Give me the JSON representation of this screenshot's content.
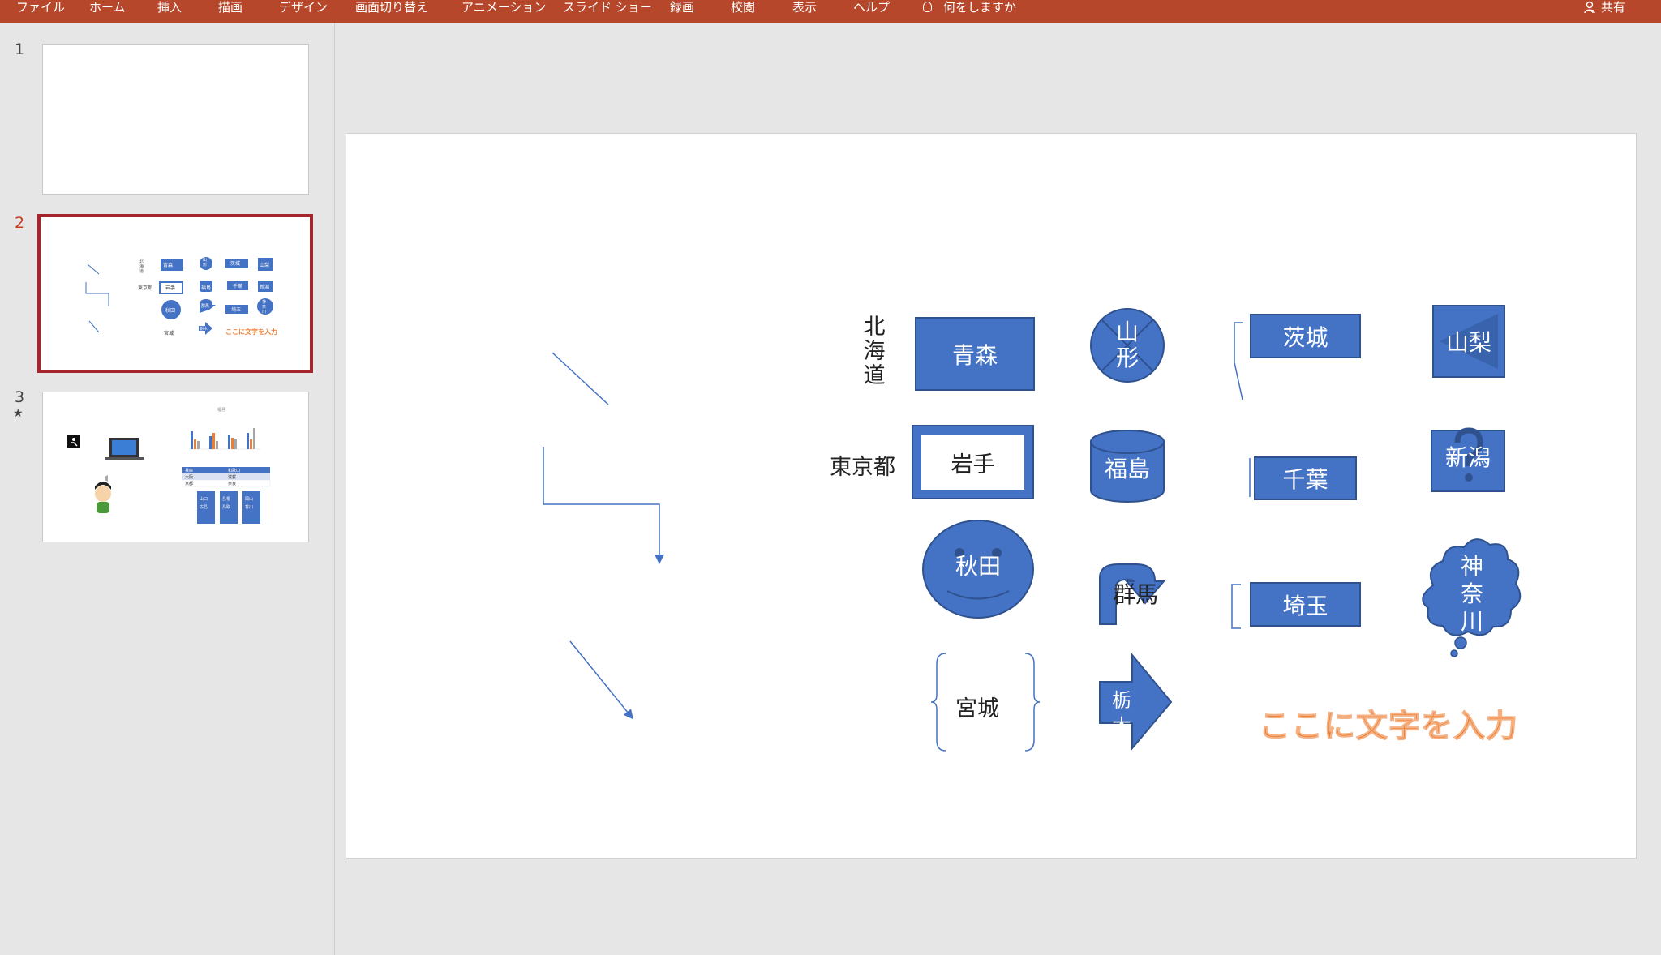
{
  "ribbon": {
    "tabs": [
      "ファイル",
      "ホーム",
      "挿入",
      "描画",
      "デザイン",
      "画面切り替え",
      "アニメーション",
      "スライド ショー",
      "録画",
      "校閲",
      "表示",
      "ヘルプ"
    ],
    "tell_me": "何をしますか",
    "share": "共有",
    "color": "#b7472a"
  },
  "thumbnails": {
    "numbers": [
      "1",
      "2",
      "3"
    ],
    "selected": "2",
    "slide3_star": "★",
    "mini2": {
      "hokkaido": "北海道",
      "aomori": "青森",
      "yamagata": "山形",
      "ibaraki": "茨城",
      "yamanashi": "山梨",
      "tokyo": "東京都",
      "iwate": "岩手",
      "fukushima": "福島",
      "chiba": "千葉",
      "niigata": "新潟",
      "akita": "秋田",
      "gunma": "群馬",
      "saitama": "埼玉",
      "kanagawa": "神奈川",
      "miyagi": "宮城",
      "tochigi": "栃木",
      "wordart": "ここに文字を入力"
    },
    "mini3": {
      "chart_title": "福島",
      "table_headers": [
        "兵庫",
        "和歌山"
      ],
      "table_rows": [
        [
          "大阪",
          "滋賀"
        ],
        [
          "京都",
          "奈良"
        ]
      ],
      "col1": [
        "山口",
        "広島"
      ],
      "col2": [
        "島根",
        "鳥取"
      ],
      "col3": [
        "岡山",
        "香川"
      ]
    }
  },
  "slide": {
    "hokkaido": "北海道",
    "aomori": "青森",
    "yamagata": "山形",
    "ibaraki": "茨城",
    "yamanashi": "山梨",
    "tokyo": "東京都",
    "iwate": "岩手",
    "fukushima": "福島",
    "chiba": "千葉",
    "niigata": "新潟",
    "akita": "秋田",
    "gunma": "群馬",
    "saitama": "埼玉",
    "kanagawa": "神奈川",
    "miyagi": "宮城",
    "tochigi": "栃木",
    "wordart": "ここに文字を入力",
    "shape_color": "#4472c4",
    "wordart_color": "#ed7d31"
  }
}
